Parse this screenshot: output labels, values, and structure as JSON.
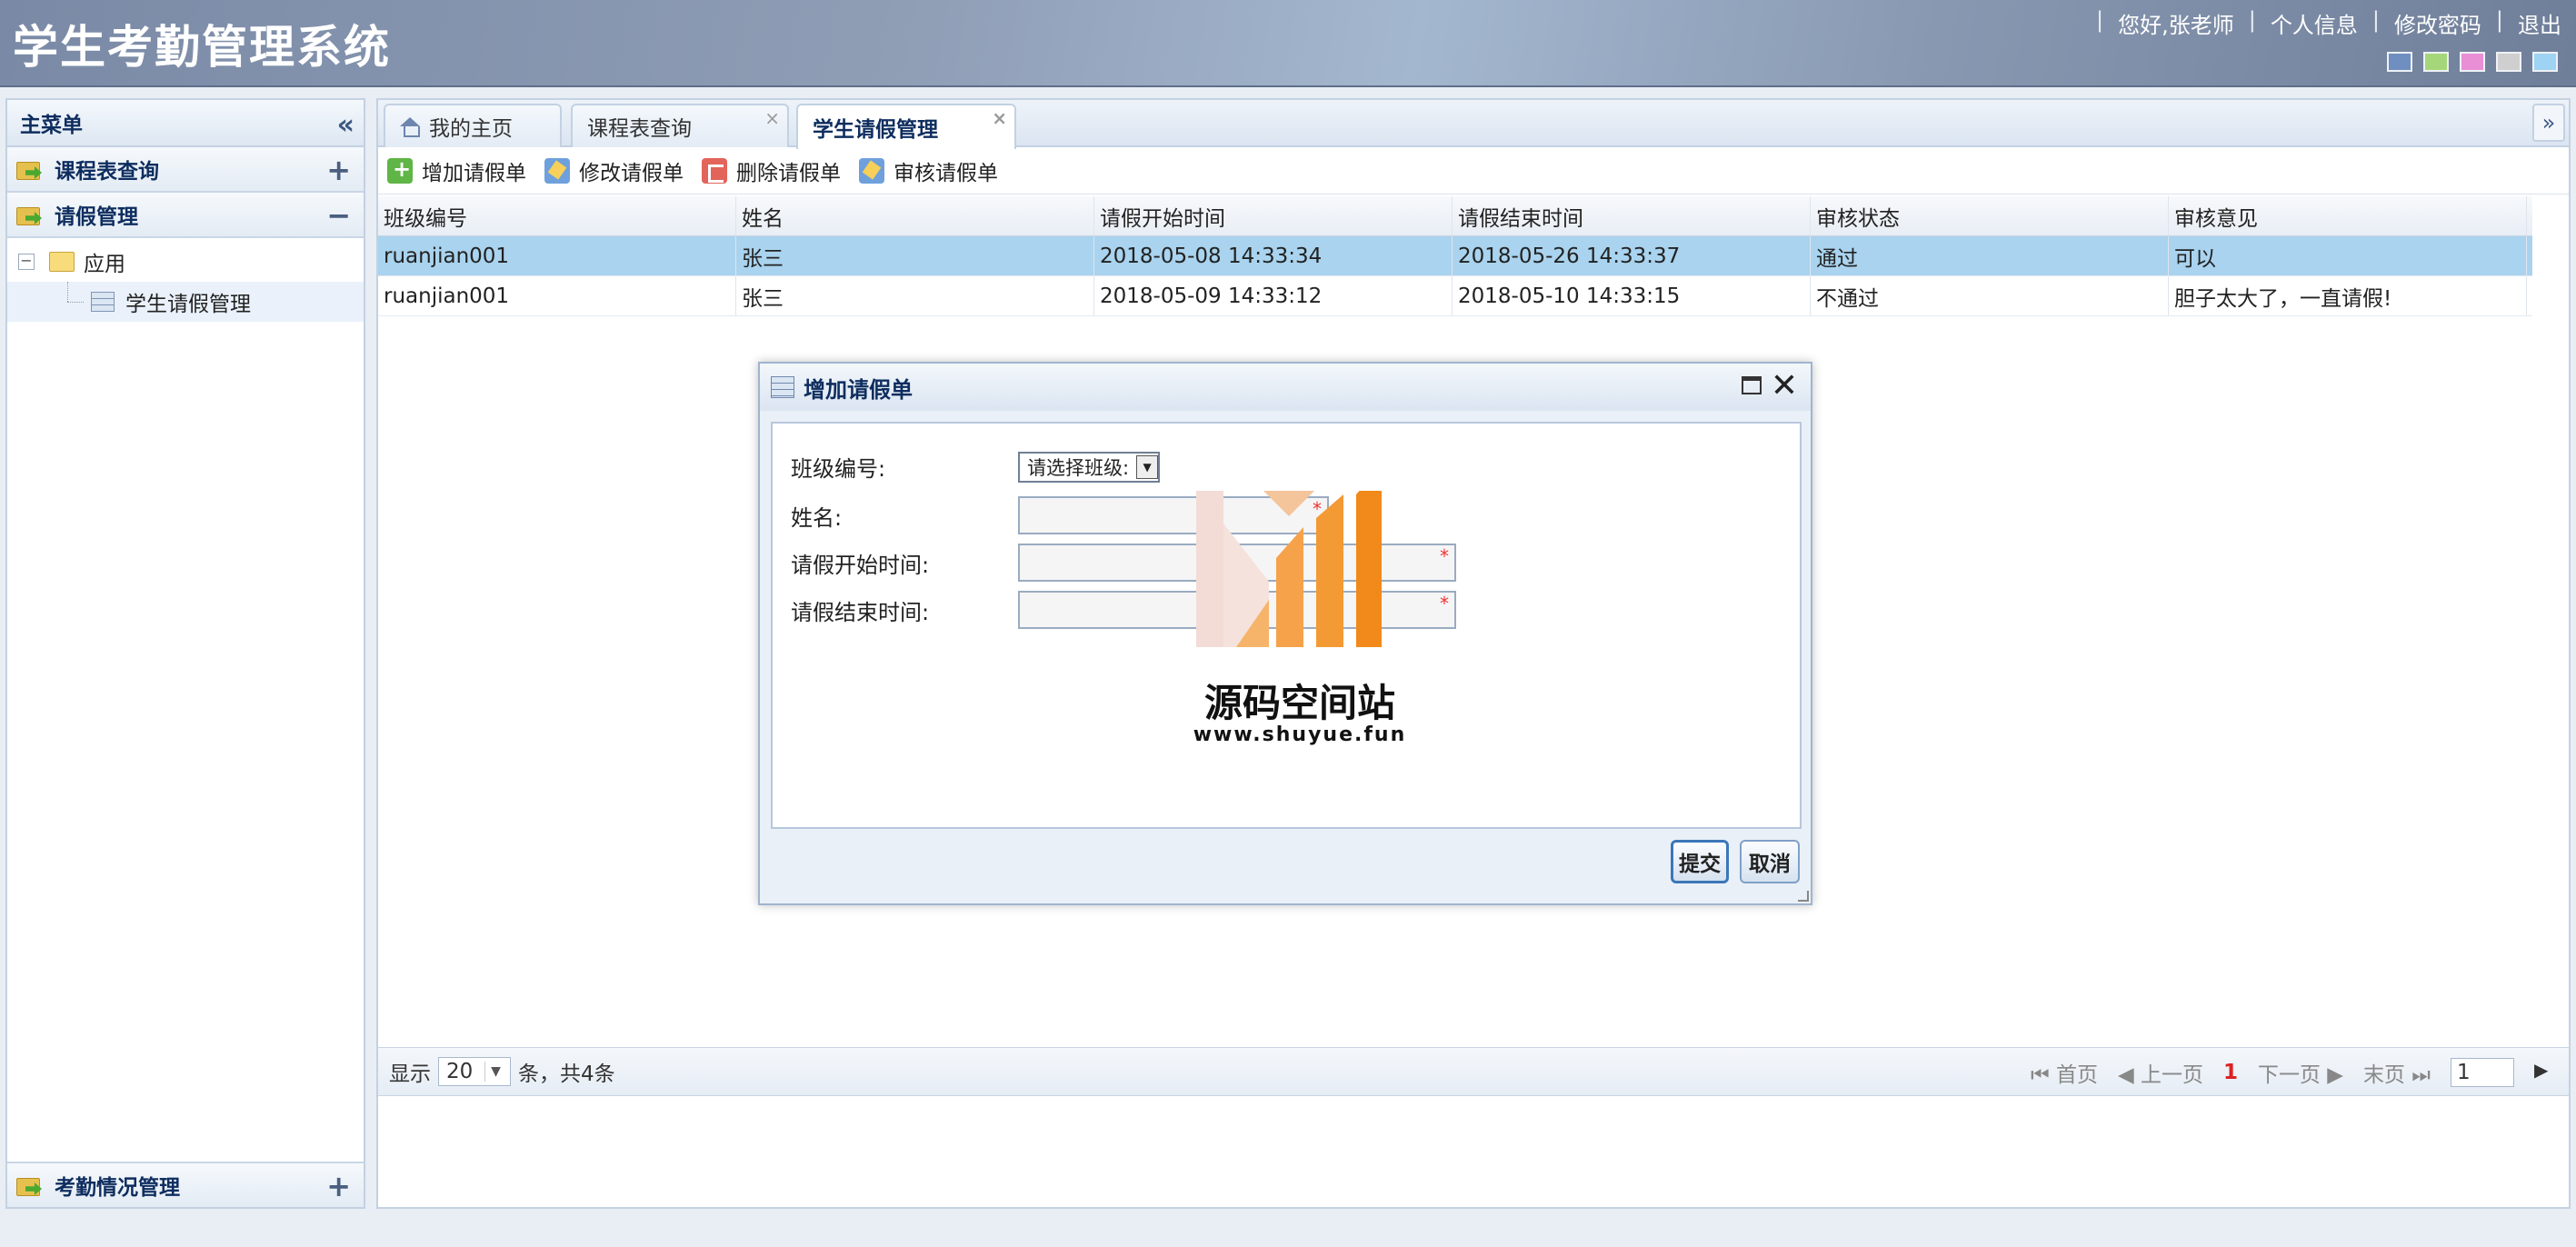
{
  "header": {
    "title": "学生考勤管理系统",
    "links": [
      "您好,张老师",
      "个人信息",
      "修改密码",
      "退出"
    ],
    "theme_colors": [
      "#6f8fc0",
      "#a5d77a",
      "#e98fd6",
      "#cfcfcf",
      "#9fd3f3"
    ]
  },
  "sidebar": {
    "title": "主菜单",
    "sections": [
      {
        "label": "课程表查询",
        "toggle": "+"
      },
      {
        "label": "请假管理",
        "toggle": "−"
      },
      {
        "label": "考勤情况管理",
        "toggle": "+"
      }
    ],
    "tree": {
      "folder": "应用",
      "items": [
        "学生请假管理"
      ]
    }
  },
  "tabs": [
    {
      "label": "我的主页",
      "icon": "home-icon"
    },
    {
      "label": "课程表查询",
      "closable": "×"
    },
    {
      "label": "学生请假管理",
      "closable": "×",
      "active": true
    }
  ],
  "toolbar": {
    "add": "增加请假单",
    "edit": "修改请假单",
    "delete": "删除请假单",
    "audit": "审核请假单"
  },
  "table": {
    "columns": [
      "班级编号",
      "姓名",
      "请假开始时间",
      "请假结束时间",
      "审核状态",
      "审核意见"
    ],
    "rows": [
      [
        "ruanjian001",
        "张三",
        "2018-05-08 14:33:34",
        "2018-05-26 14:33:37",
        "通过",
        "可以"
      ],
      [
        "ruanjian001",
        "张三",
        "2018-05-09 14:33:12",
        "2018-05-10 14:33:15",
        "不通过",
        "胆子太大了，一直请假!"
      ]
    ]
  },
  "pager": {
    "show": "显示",
    "page_size": "20",
    "summary": "条，共4条",
    "first": "首页",
    "prev": "上一页",
    "current": "1",
    "next": "下一页",
    "last": "末页",
    "page_input": "1"
  },
  "dialog": {
    "title": "增加请假单",
    "fields": {
      "class_label": "班级编号:",
      "class_select": "请选择班级:",
      "name_label": "姓名:",
      "start_label": "请假开始时间:",
      "end_label": "请假结束时间:",
      "required_mark": "*"
    },
    "submit": "提交",
    "cancel": "取消"
  },
  "watermark": {
    "text": "源码空间站",
    "url": "www.shuyue.fun",
    "colors": [
      "#f1d6cf",
      "#f5a24a",
      "#f18a1a"
    ]
  }
}
